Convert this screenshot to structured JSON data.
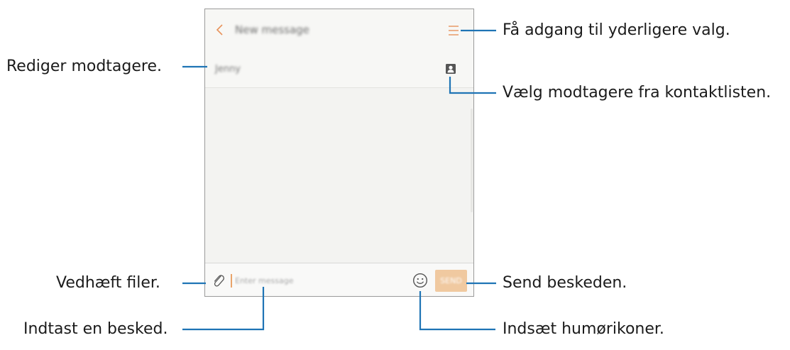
{
  "app": {
    "title": "New message",
    "recipient": "Jenny",
    "message_placeholder": "Enter message",
    "send_label": "SEND",
    "accent_color": "#e8935c"
  },
  "icons": [
    "back-icon",
    "menu-icon",
    "contact-icon",
    "paperclip-icon",
    "emoji-icon"
  ],
  "callouts": {
    "more_options": "Få adgang til yderligere valg.",
    "edit_recipients": "Rediger modtagere.",
    "choose_contacts": "Vælg modtagere fra kontaktlisten.",
    "attach_files": "Vedhæft filer.",
    "send_message": "Send beskeden.",
    "enter_message": "Indtast en besked.",
    "insert_emoticons": "Indsæt humørikoner."
  }
}
